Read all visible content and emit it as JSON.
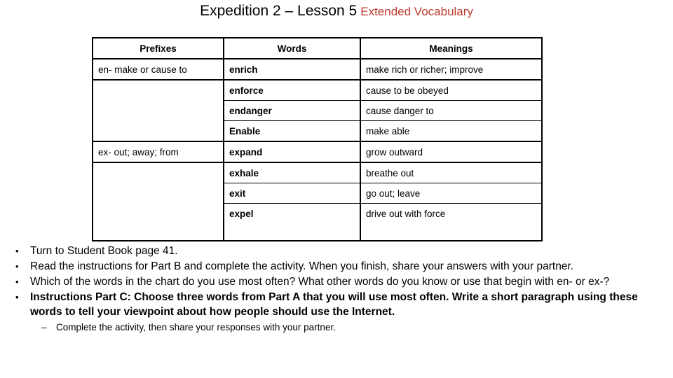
{
  "title": {
    "main": "Expedition 2 – Lesson 5",
    "sub": "Extended  Vocabulary",
    "sub_color": "#BE3A30"
  },
  "table": {
    "headers": [
      "Prefixes",
      "Words",
      "Meanings"
    ],
    "groups": [
      {
        "prefix": "en- make or cause to",
        "rows": [
          {
            "word": "enrich",
            "meaning": "make rich or richer; improve"
          },
          {
            "word": "enforce",
            "meaning": "cause to be obeyed"
          },
          {
            "word": "endanger",
            "meaning": "cause danger to"
          },
          {
            "word": "Enable",
            "meaning": "make able"
          }
        ]
      },
      {
        "prefix": "ex- out; away; from",
        "rows": [
          {
            "word": "expand",
            "meaning": "grow outward"
          },
          {
            "word": "exhale",
            "meaning": "breathe out"
          },
          {
            "word": "exit",
            "meaning": "go out; leave"
          },
          {
            "word": "expel",
            "meaning": "drive out with force"
          }
        ]
      }
    ]
  },
  "instructions": {
    "bullets": [
      {
        "text": "Turn to Student Book page 41.",
        "bold": false
      },
      {
        "text": "Read the instructions for Part B and complete the activity. When you finish, share your answers with your partner.",
        "bold": false
      },
      {
        "text": " Which of the words in the chart do you use most often? What other words do you know or use that begin with en- or ex-?",
        "bold": false
      },
      {
        "text": "Instructions Part C:  Choose three words from Part A that you will use most often. Write a short paragraph using these words to tell your viewpoint about how people should use the Internet.",
        "bold": true,
        "sub": [
          "Complete the activity, then share your responses with your partner."
        ]
      }
    ]
  }
}
